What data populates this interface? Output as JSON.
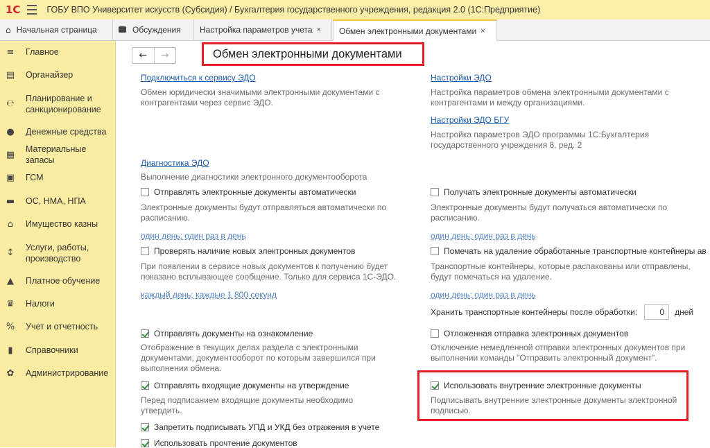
{
  "window": {
    "logo": "1С",
    "title": "ГОБУ ВПО Университет искусств (Субсидия) / Бухгалтерия государственного учреждения, редакция 2.0  (1С:Предприятие)"
  },
  "tabs": [
    {
      "label": "Начальная страница",
      "icon": "home-icon"
    },
    {
      "label": "Обсуждения",
      "icon": "discussion-icon"
    },
    {
      "label": "Настройка параметров учета",
      "close": "×"
    },
    {
      "label": "Обмен электронными документами",
      "close": "×"
    }
  ],
  "sidebar": {
    "items": [
      {
        "label": "Главное",
        "icon": "menu-icon"
      },
      {
        "label": "Органайзер",
        "icon": "organizer-icon"
      },
      {
        "label": "Планирование и санкционирование",
        "icon": "planning-icon"
      },
      {
        "label": "Денежные средства",
        "icon": "money-icon"
      },
      {
        "label": "Материальные запасы",
        "icon": "inventory-icon"
      },
      {
        "label": "ГСМ",
        "icon": "fuel-icon"
      },
      {
        "label": "ОС, НМА, НПА",
        "icon": "truck-icon"
      },
      {
        "label": "Имущество казны",
        "icon": "treasury-icon"
      },
      {
        "label": "Услуги, работы, производство",
        "icon": "services-icon"
      },
      {
        "label": "Платное обучение",
        "icon": "education-icon"
      },
      {
        "label": "Налоги",
        "icon": "tax-icon"
      },
      {
        "label": "Учет и отчетность",
        "icon": "reports-icon"
      },
      {
        "label": "Справочники",
        "icon": "directory-icon"
      },
      {
        "label": "Администрирование",
        "icon": "gear-icon"
      }
    ]
  },
  "page": {
    "title": "Обмен электронными документами",
    "connect_link": "Подключиться к сервису ЭДО",
    "connect_desc": "Обмен юридически значимыми электронными документами с контрагентами через сервис ЭДО.",
    "edo_settings_link": "Настройки ЭДО",
    "edo_settings_desc": "Настройка параметров обмена электронными документами с контрагентами и между организациями.",
    "bgu_settings_link": "Настройки ЭДО БГУ",
    "bgu_settings_desc": "Настройка параметров ЭДО программы 1С:Бухгалтерия государственного учреждения 8, ред. 2",
    "diag_link": "Диагностика ЭДО",
    "diag_desc": "Выполнение диагностики электронного документооборота",
    "auto_send": {
      "label": "Отправлять электронные документы автоматически",
      "checked": false,
      "desc": "Электронные документы будут отправляться автоматически по расписанию.",
      "schedule": "один день; один раз в день"
    },
    "auto_receive": {
      "label": "Получать электронные документы автоматически",
      "checked": false,
      "desc": "Электронные документы будут получаться автоматически по расписанию.",
      "schedule": "один день; один раз в день"
    },
    "check_new": {
      "label": "Проверять наличие новых электронных документов",
      "checked": false,
      "desc": "При появлении в сервисе новых документов к получению будет показано всплывающее сообщение. Только для сервиса 1С-ЭДО.",
      "schedule": "каждый день; каждые 1 800 секунд"
    },
    "mark_delete": {
      "label": "Помечать на удаление обработанные транспортные контейнеры ав",
      "checked": false,
      "desc": "Транспортные контейнеры, которые распакованы или отправлены, будут помечаться на удаление.",
      "schedule": "один день; один раз в день"
    },
    "storage": {
      "label": "Хранить транспортные контейнеры после обработки:",
      "value": "0",
      "unit": "дней"
    },
    "send_review": {
      "label": "Отправлять документы на ознакомление",
      "checked": true,
      "desc": "Отображение в текущих делах  раздела с электронными документами, документооборот по которым завершился при выполнении обмена."
    },
    "deferred": {
      "label": "Отложенная отправка электронных документов",
      "checked": false,
      "desc": "Отключение немедленной отправки электронных документов при выполнении команды \"Отправить электронный документ\"."
    },
    "send_incoming": {
      "label": "Отправлять входящие документы на утверждение",
      "checked": true,
      "desc": "Перед подписанием входящие документы необходимо утвердить."
    },
    "internal_docs": {
      "label": "Использовать внутренние электронные документы",
      "checked": true,
      "desc": "Подписывать внутренние электронные документы электронной подписью."
    },
    "forbid_sign": {
      "label": "Запретить подписывать УПД и УКД без отражения в учете",
      "checked": true
    },
    "use_reading": {
      "label": "Использовать прочтение документов",
      "checked": true
    }
  }
}
